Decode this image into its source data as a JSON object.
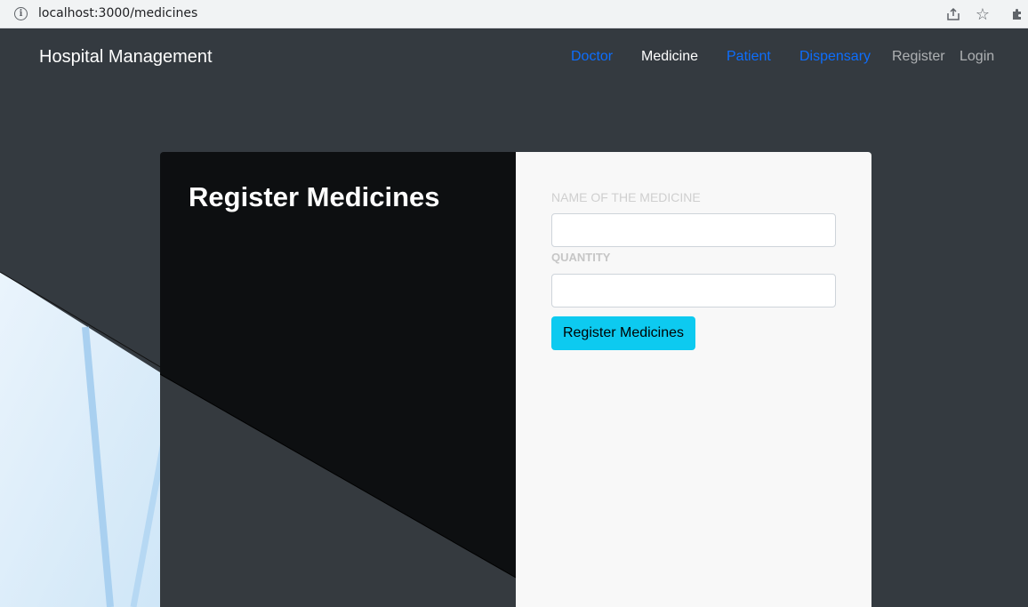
{
  "browser": {
    "url": "localhost:3000/medicines"
  },
  "navbar": {
    "brand": "Hospital Management",
    "links": [
      {
        "label": "Doctor"
      },
      {
        "label": "Medicine"
      },
      {
        "label": "Patient"
      },
      {
        "label": "Dispensary"
      },
      {
        "label": "Register"
      },
      {
        "label": "Login"
      }
    ]
  },
  "card": {
    "title": "Register Medicines",
    "form": {
      "name_label": "NAME OF THE MEDICINE",
      "name_value": "",
      "quantity_label": "QUANTITY",
      "quantity_value": "",
      "submit_label": "Register Medicines"
    }
  },
  "colors": {
    "page_bg": "#343a40",
    "link_blue": "#0d6efd",
    "button_cyan": "#0dcaf0",
    "card_dark": "#0d0f11",
    "card_light": "#f8f8f8"
  }
}
